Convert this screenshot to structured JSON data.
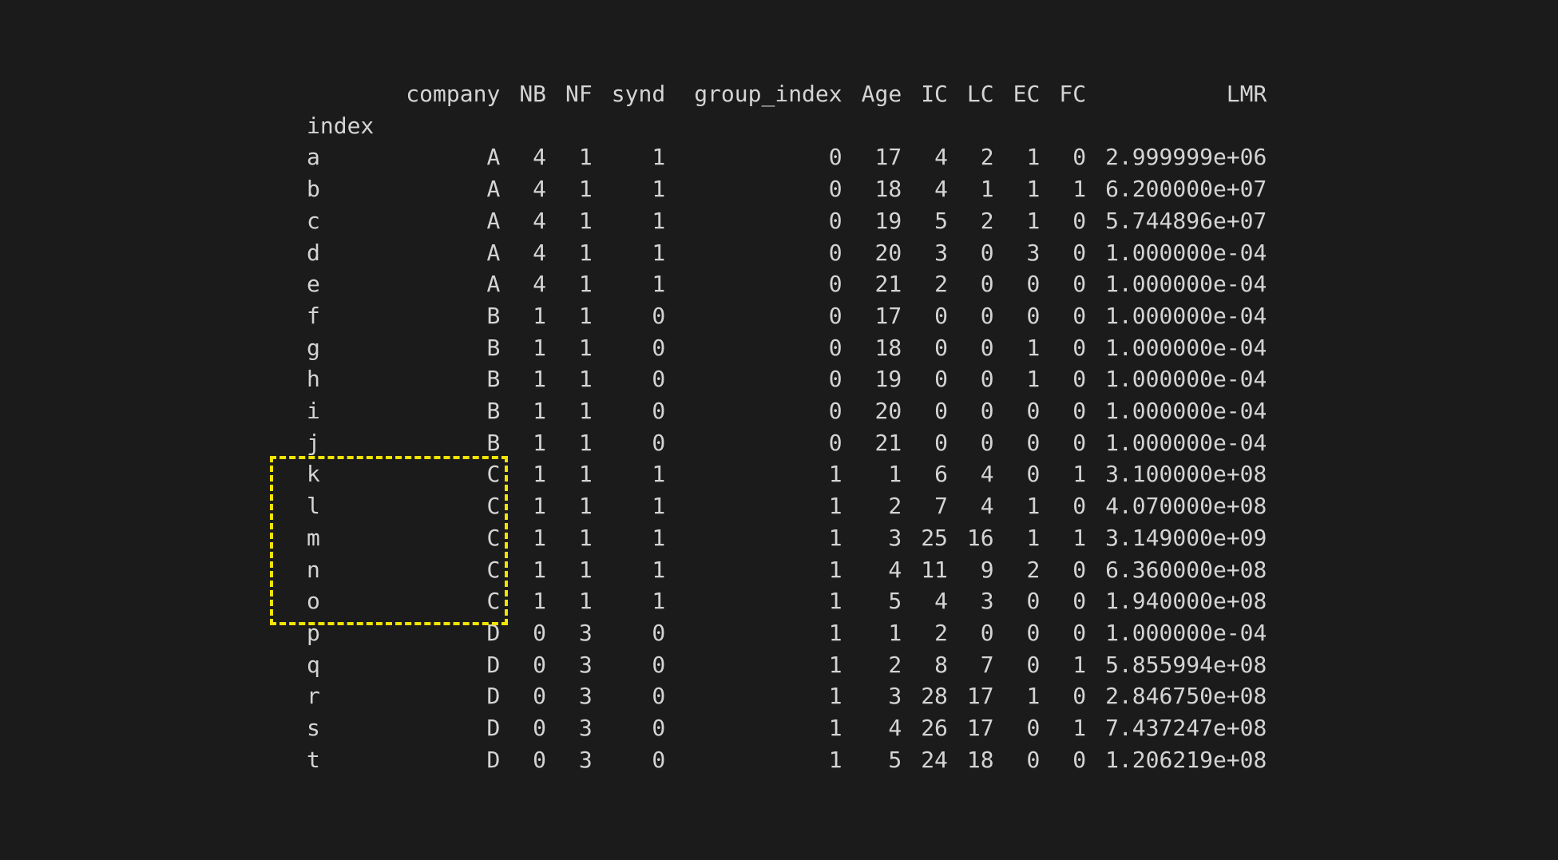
{
  "table": {
    "columns": [
      "company",
      "NB",
      "NF",
      "synd",
      "group_index",
      "Age",
      "IC",
      "LC",
      "EC",
      "FC",
      "LMR"
    ],
    "index_name": "index",
    "rows": [
      [
        "a",
        "A",
        "4",
        "1",
        "1",
        "0",
        "17",
        "4",
        "2",
        "1",
        "0",
        "2.999999e+06"
      ],
      [
        "b",
        "A",
        "4",
        "1",
        "1",
        "0",
        "18",
        "4",
        "1",
        "1",
        "1",
        "6.200000e+07"
      ],
      [
        "c",
        "A",
        "4",
        "1",
        "1",
        "0",
        "19",
        "5",
        "2",
        "1",
        "0",
        "5.744896e+07"
      ],
      [
        "d",
        "A",
        "4",
        "1",
        "1",
        "0",
        "20",
        "3",
        "0",
        "3",
        "0",
        "1.000000e-04"
      ],
      [
        "e",
        "A",
        "4",
        "1",
        "1",
        "0",
        "21",
        "2",
        "0",
        "0",
        "0",
        "1.000000e-04"
      ],
      [
        "f",
        "B",
        "1",
        "1",
        "0",
        "0",
        "17",
        "0",
        "0",
        "0",
        "0",
        "1.000000e-04"
      ],
      [
        "g",
        "B",
        "1",
        "1",
        "0",
        "0",
        "18",
        "0",
        "0",
        "1",
        "0",
        "1.000000e-04"
      ],
      [
        "h",
        "B",
        "1",
        "1",
        "0",
        "0",
        "19",
        "0",
        "0",
        "1",
        "0",
        "1.000000e-04"
      ],
      [
        "i",
        "B",
        "1",
        "1",
        "0",
        "0",
        "20",
        "0",
        "0",
        "0",
        "0",
        "1.000000e-04"
      ],
      [
        "j",
        "B",
        "1",
        "1",
        "0",
        "0",
        "21",
        "0",
        "0",
        "0",
        "0",
        "1.000000e-04"
      ],
      [
        "k",
        "C",
        "1",
        "1",
        "1",
        "1",
        "1",
        "6",
        "4",
        "0",
        "1",
        "3.100000e+08"
      ],
      [
        "l",
        "C",
        "1",
        "1",
        "1",
        "1",
        "2",
        "7",
        "4",
        "1",
        "0",
        "4.070000e+08"
      ],
      [
        "m",
        "C",
        "1",
        "1",
        "1",
        "1",
        "3",
        "25",
        "16",
        "1",
        "1",
        "3.149000e+09"
      ],
      [
        "n",
        "C",
        "1",
        "1",
        "1",
        "1",
        "4",
        "11",
        "9",
        "2",
        "0",
        "6.360000e+08"
      ],
      [
        "o",
        "C",
        "1",
        "1",
        "1",
        "1",
        "5",
        "4",
        "3",
        "0",
        "0",
        "1.940000e+08"
      ],
      [
        "p",
        "D",
        "0",
        "3",
        "0",
        "1",
        "1",
        "2",
        "0",
        "0",
        "0",
        "1.000000e-04"
      ],
      [
        "q",
        "D",
        "0",
        "3",
        "0",
        "1",
        "2",
        "8",
        "7",
        "0",
        "1",
        "5.855994e+08"
      ],
      [
        "r",
        "D",
        "0",
        "3",
        "0",
        "1",
        "3",
        "28",
        "17",
        "1",
        "0",
        "2.846750e+08"
      ],
      [
        "s",
        "D",
        "0",
        "3",
        "0",
        "1",
        "4",
        "26",
        "17",
        "0",
        "1",
        "7.437247e+08"
      ],
      [
        "t",
        "D",
        "0",
        "3",
        "0",
        "1",
        "5",
        "24",
        "18",
        "0",
        "0",
        "1.206219e+08"
      ]
    ]
  },
  "colors": {
    "background": "#1b1b1b",
    "text": "#d4d4d4",
    "highlight": "#f2e300"
  }
}
